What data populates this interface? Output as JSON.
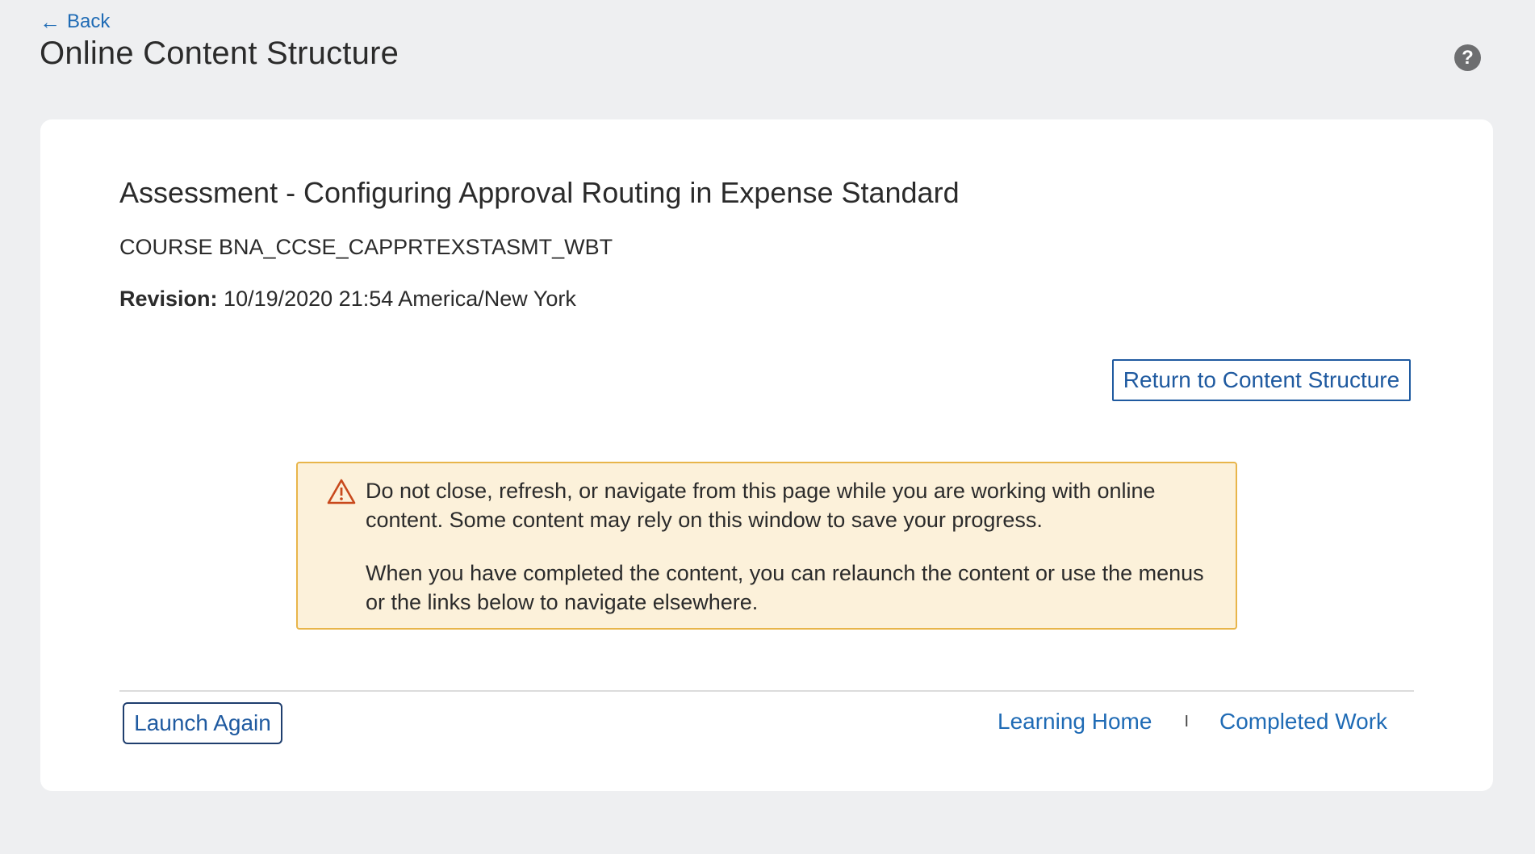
{
  "header": {
    "back_arrow": "←",
    "back_label": "Back",
    "title": "Online Content Structure",
    "help_glyph": "?",
    "help_icon": "question-circle-icon"
  },
  "content": {
    "title": "Assessment - Configuring Approval Routing in Expense Standard",
    "course_code": "COURSE BNA_CCSE_CAPPRTEXSTASMT_WBT",
    "revision_label": "Revision:",
    "revision_value": "10/19/2020 21:54 America/New York",
    "return_button": "Return to Content Structure"
  },
  "warning": {
    "icon": "warning-triangle-icon",
    "paragraph_1": "Do not close, refresh, or navigate from this page while you are working with online content. Some content may rely on this window to save your progress.",
    "paragraph_2": "When you have completed the content, you can relaunch the content or use the menus or the links below to navigate elsewhere."
  },
  "footer": {
    "launch_again": "Launch Again",
    "learning_home": "Learning Home",
    "separator": "I",
    "completed_work": "Completed Work"
  },
  "colors": {
    "background": "#eeeff1",
    "card": "#ffffff",
    "link": "#1f6bb5",
    "warning_bg": "#fcf1da",
    "warning_border": "#e8b54a",
    "warning_icon": "#c8491c"
  }
}
